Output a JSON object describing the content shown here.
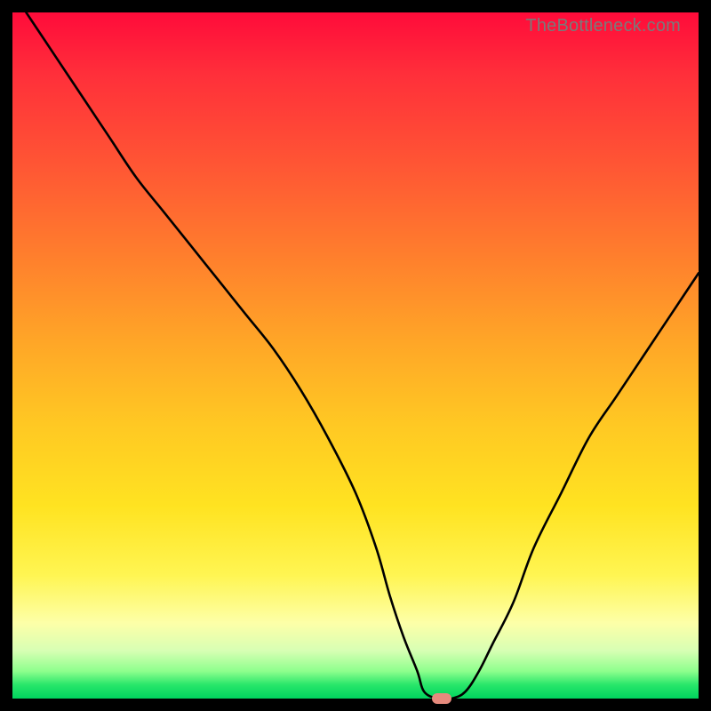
{
  "watermark": "TheBottleneck.com",
  "gradient_colors": {
    "top": "#ff0b3a",
    "mid_orange": "#ff7d2d",
    "yellow": "#ffe321",
    "pale": "#fdffa8",
    "green": "#00d45e"
  },
  "chart_data": {
    "type": "line",
    "title": "",
    "xlabel": "",
    "ylabel": "",
    "xlim": [
      0,
      100
    ],
    "ylim": [
      0,
      100
    ],
    "x": [
      2,
      6,
      10,
      14,
      18,
      22,
      26,
      30,
      34,
      38,
      42,
      46,
      50,
      53,
      55,
      57,
      59,
      60,
      62,
      64,
      66,
      68,
      70,
      73,
      76,
      80,
      84,
      88,
      92,
      96,
      100
    ],
    "values": [
      100,
      94,
      88,
      82,
      76,
      71,
      66,
      61,
      56,
      51,
      45,
      38,
      30,
      22,
      15,
      9,
      4,
      1,
      0,
      0,
      1,
      4,
      8,
      14,
      22,
      30,
      38,
      44,
      50,
      56,
      62
    ],
    "marker": {
      "x": 62.5,
      "y": 0
    },
    "grid": false,
    "legend": false
  }
}
